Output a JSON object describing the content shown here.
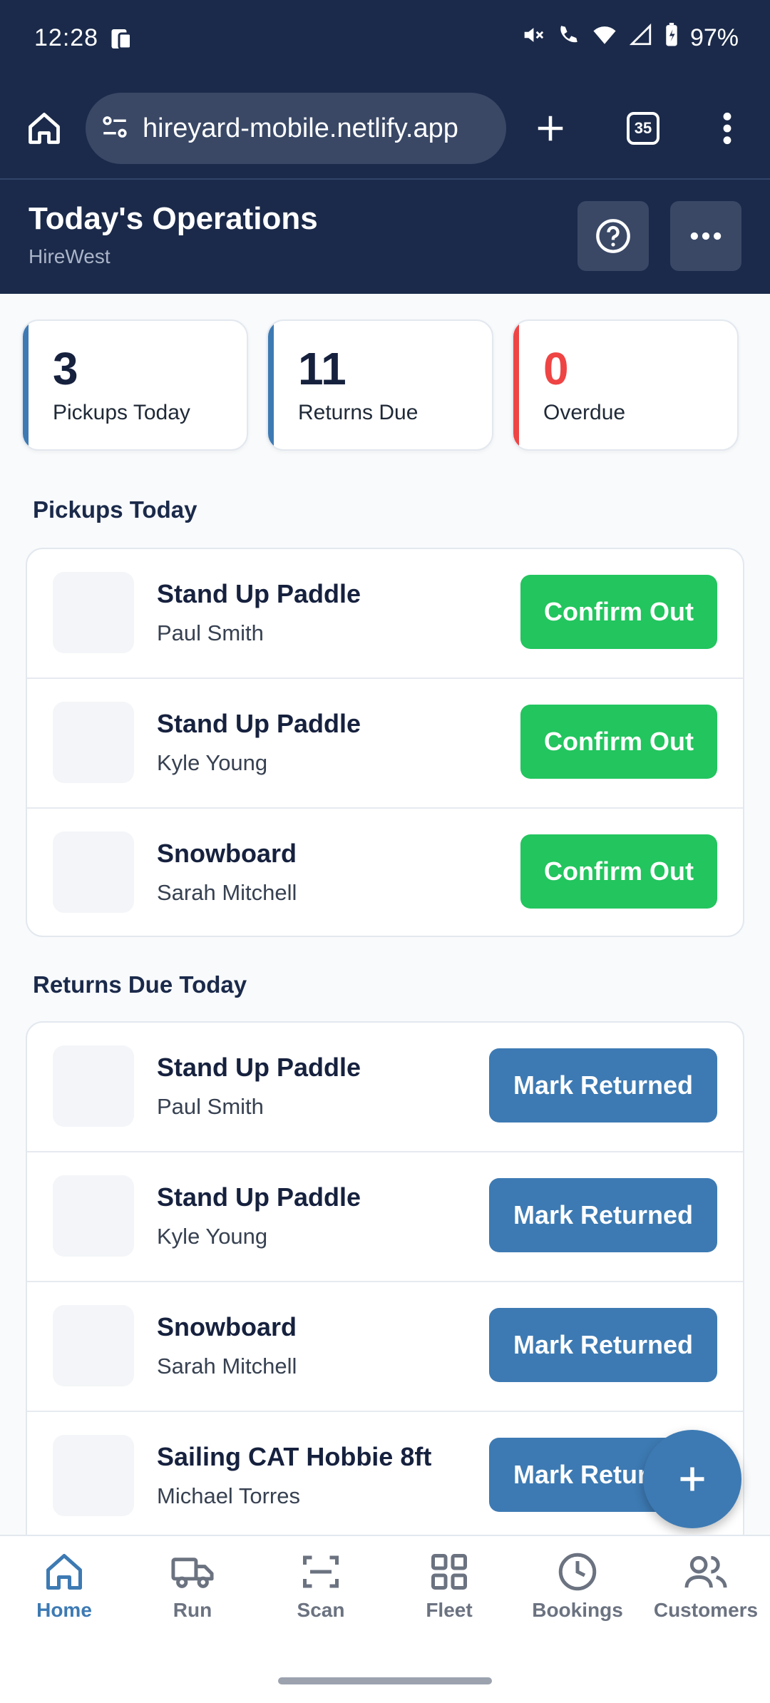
{
  "status_bar": {
    "time": "12:28",
    "battery": "97%"
  },
  "browser": {
    "url": "hireyard-mobile.netlify.app",
    "tab_count": "35"
  },
  "header": {
    "title": "Today's Operations",
    "subtitle": "HireWest"
  },
  "stats": [
    {
      "value": "3",
      "label": "Pickups Today",
      "accent": "#3d7ab3",
      "value_color": "#16213e"
    },
    {
      "value": "11",
      "label": "Returns Due",
      "accent": "#3d7ab3",
      "value_color": "#16213e"
    },
    {
      "value": "0",
      "label": "Overdue",
      "accent": "#ef4444",
      "value_color": "#ef4444"
    }
  ],
  "pickups": {
    "title": "Pickups Today",
    "items": [
      {
        "item": "Stand Up Paddle",
        "customer": "Paul Smith",
        "action": "Confirm Out"
      },
      {
        "item": "Stand Up Paddle",
        "customer": "Kyle Young",
        "action": "Confirm Out"
      },
      {
        "item": "Snowboard",
        "customer": "Sarah Mitchell",
        "action": "Confirm Out"
      }
    ]
  },
  "returns": {
    "title": "Returns Due Today",
    "items": [
      {
        "item": "Stand Up Paddle",
        "customer": "Paul Smith",
        "action": "Mark Returned"
      },
      {
        "item": "Stand Up Paddle",
        "customer": "Kyle Young",
        "action": "Mark Returned"
      },
      {
        "item": "Snowboard",
        "customer": "Sarah Mitchell",
        "action": "Mark Returned"
      },
      {
        "item": "Sailing CAT Hobbie 8ft",
        "customer": "Michael Torres",
        "action": "Mark Returned"
      }
    ]
  },
  "fab": {
    "icon": "plus-icon"
  },
  "nav": [
    {
      "label": "Home",
      "icon": "home-icon",
      "active": true
    },
    {
      "label": "Run",
      "icon": "truck-icon"
    },
    {
      "label": "Scan",
      "icon": "scan-icon"
    },
    {
      "label": "Fleet",
      "icon": "grid-icon"
    },
    {
      "label": "Bookings",
      "icon": "clock-icon"
    },
    {
      "label": "Customers",
      "icon": "users-icon"
    }
  ],
  "colors": {
    "navy": "#1b2a4a",
    "green": "#22c55e",
    "blue": "#3d7ab3",
    "red": "#ef4444"
  }
}
